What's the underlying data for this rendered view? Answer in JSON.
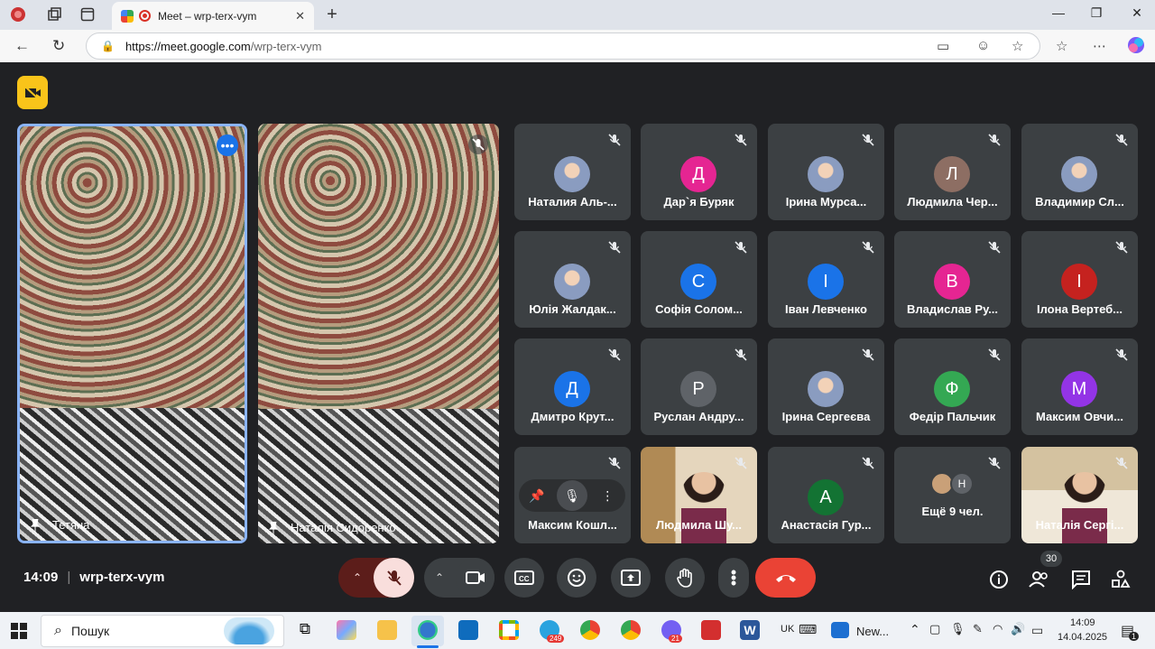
{
  "browser": {
    "tab_title": "Meet – wrp-terx-vym",
    "url_host": "https://meet.google.com",
    "url_path": "/wrp-terx-vym"
  },
  "meeting": {
    "time": "14:09",
    "code": "wrp-terx-vym",
    "participant_count": "30"
  },
  "spotlight": [
    {
      "name": "Тетяна"
    },
    {
      "name": "Наталія Сидоренко"
    }
  ],
  "tiles": [
    {
      "name": "Наталия Аль-...",
      "initial": "",
      "color": "#ffffff",
      "photo": true
    },
    {
      "name": "Дар`я Буряк",
      "initial": "Д",
      "color": "#e52592"
    },
    {
      "name": "Ірина Мурса...",
      "initial": "",
      "color": "#8ab4f8",
      "photo": true
    },
    {
      "name": "Людмила Чер...",
      "initial": "Л",
      "color": "#8d6e63"
    },
    {
      "name": "Владимир Сл...",
      "initial": "",
      "color": "#5f6368",
      "photo": true
    },
    {
      "name": "Юлія Жалдак...",
      "initial": "",
      "color": "#ffffff",
      "photo": true
    },
    {
      "name": "Софія Солом...",
      "initial": "С",
      "color": "#1a73e8"
    },
    {
      "name": "Іван Левченко",
      "initial": "І",
      "color": "#1a73e8"
    },
    {
      "name": "Владислав Ру...",
      "initial": "В",
      "color": "#e52592"
    },
    {
      "name": "Ілона Вертеб...",
      "initial": "І",
      "color": "#c5221f"
    },
    {
      "name": "Дмитро Крут...",
      "initial": "Д",
      "color": "#1a73e8"
    },
    {
      "name": "Руслан Андру...",
      "initial": "Р",
      "color": "#5f6368"
    },
    {
      "name": "Ірина Сергеєва",
      "initial": "",
      "color": "#5f6368",
      "photo": true
    },
    {
      "name": "Федір Пальчик",
      "initial": "Ф",
      "color": "#34a853"
    },
    {
      "name": "Максим Овчи...",
      "initial": "М",
      "color": "#9334e6"
    },
    {
      "name": "Максим Кошл...",
      "initial": "",
      "color": "#5f6368"
    },
    {
      "name": "Людмила Шу...",
      "initial": "",
      "color": "#5f6368",
      "video": true
    },
    {
      "name": "Анастасія Гур...",
      "initial": "А",
      "color": "#137333"
    },
    {
      "name": "Ещё 9 чел.",
      "initial": "Н",
      "color": "#5f6368"
    },
    {
      "name": "Наталія Сергі...",
      "initial": "",
      "color": "#5f6368",
      "video": true
    }
  ],
  "taskbar": {
    "search_placeholder": "Пошук",
    "lang": "UK",
    "news_label": "New...",
    "clock_time": "14:09",
    "clock_date": "14.04.2025",
    "telegram_badge": "249",
    "viber_badge": "21",
    "notif_badge": "1"
  },
  "colors": {
    "end_call": "#ea4335",
    "mic_off_bg": "#f9dedc",
    "highlight_border": "#8ab4f8",
    "cam_badge": "#f9c41a"
  }
}
